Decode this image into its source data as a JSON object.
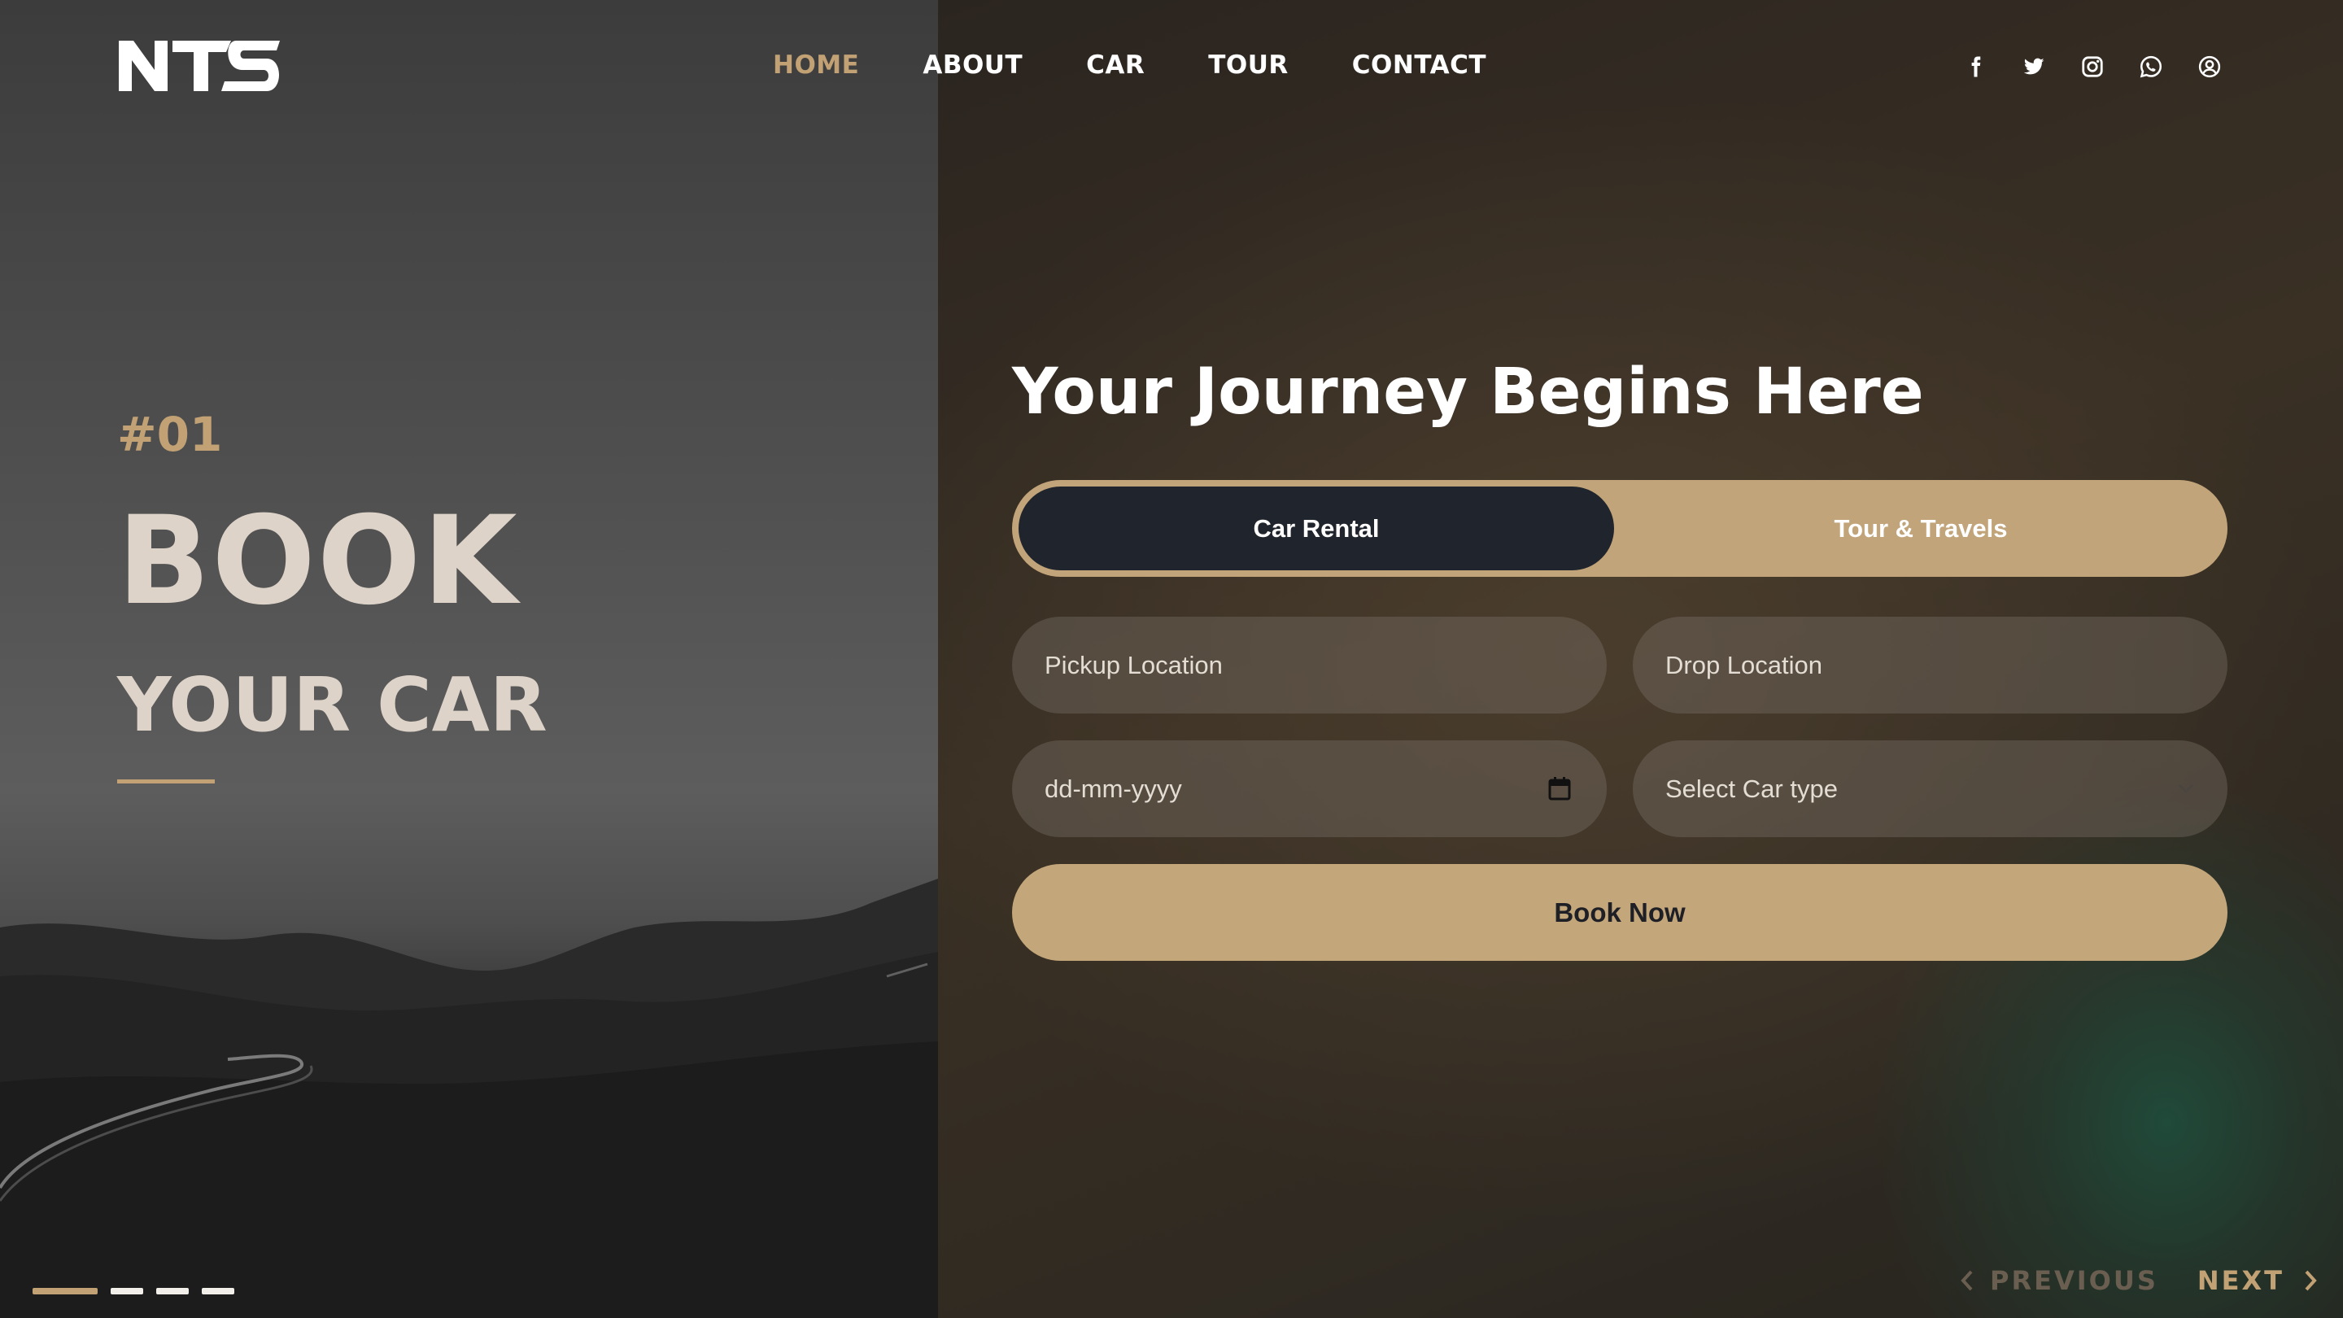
{
  "brand": {
    "logo_text": "NTS"
  },
  "nav": {
    "items": [
      {
        "label": "HOME",
        "active": true
      },
      {
        "label": "ABOUT",
        "active": false
      },
      {
        "label": "CAR",
        "active": false
      },
      {
        "label": "TOUR",
        "active": false
      },
      {
        "label": "CONTACT",
        "active": false
      }
    ]
  },
  "social": [
    "facebook-icon",
    "twitter-icon",
    "instagram-icon",
    "whatsapp-icon",
    "user-account-icon"
  ],
  "hero": {
    "slide_number": "#01",
    "title": "BOOK",
    "subtitle": "YOUR CAR"
  },
  "form": {
    "title": "Your Journey Begins Here",
    "tabs": [
      {
        "label": "Car Rental",
        "active": true
      },
      {
        "label": "Tour & Travels",
        "active": false
      }
    ],
    "pickup_placeholder": "Pickup Location",
    "drop_placeholder": "Drop Location",
    "date_placeholder": "dd-mm-yyyy",
    "car_type_placeholder": "Select Car type",
    "submit_label": "Book Now"
  },
  "slider": {
    "dots": [
      true,
      false,
      false,
      false
    ],
    "prev_label": "PREVIOUS",
    "next_label": "NEXT"
  },
  "colors": {
    "accent": "#c2a275",
    "dark_tab": "#20242c",
    "hero_text": "#ddd3c8"
  }
}
